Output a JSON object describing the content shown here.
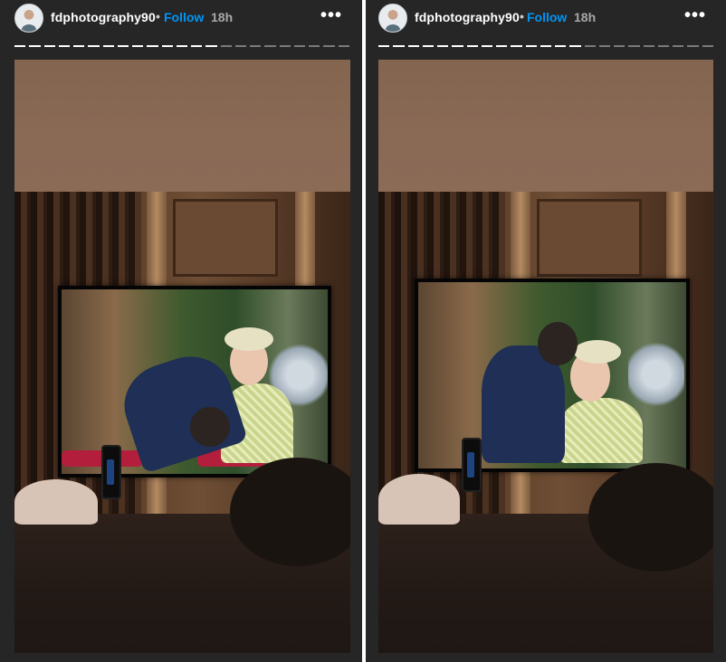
{
  "stories": [
    {
      "username": "fdphotography90",
      "separator": "•",
      "follow_label": "Follow",
      "time": "18h",
      "more_icon": "⋯",
      "progress": {
        "total_segments": 23,
        "completed_segments": 14
      },
      "photo_description_icon": "story-photo"
    },
    {
      "username": "fdphotography90",
      "separator": "•",
      "follow_label": "Follow",
      "time": "18h",
      "more_icon": "⋯",
      "progress": {
        "total_segments": 23,
        "completed_segments": 14
      },
      "photo_description_icon": "story-photo"
    }
  ],
  "colors": {
    "background": "#262626",
    "follow": "#0095f6",
    "time": "#a8a8a8",
    "progress_done": "#ffffff",
    "progress_pending": "#7a7a7a"
  }
}
